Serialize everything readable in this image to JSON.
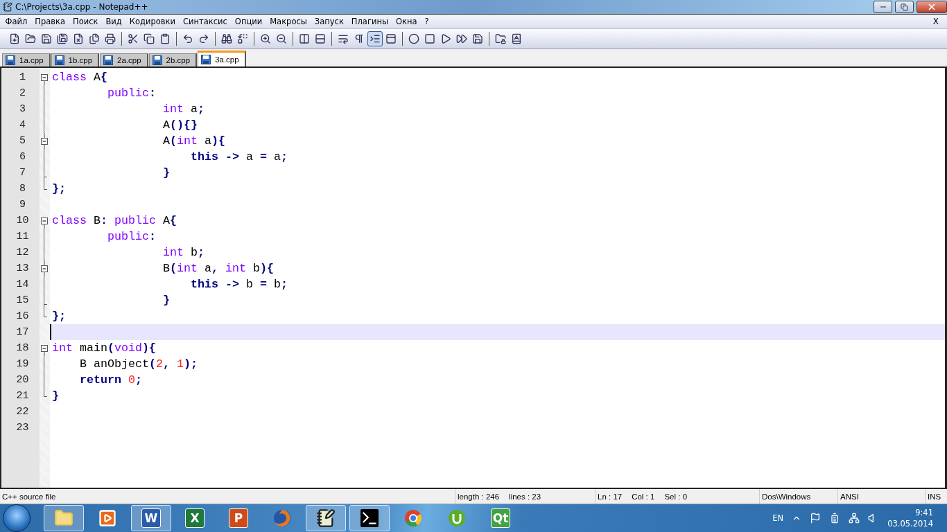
{
  "window": {
    "title": "C:\\Projects\\3a.cpp - Notepad++"
  },
  "menu": {
    "items": [
      "Файл",
      "Правка",
      "Поиск",
      "Вид",
      "Кодировки",
      "Синтаксис",
      "Опции",
      "Макросы",
      "Запуск",
      "Плагины",
      "Окна",
      "?"
    ],
    "close": "X"
  },
  "toolbar": [
    {
      "kind": "new",
      "selected": false
    },
    {
      "kind": "open",
      "selected": false
    },
    {
      "kind": "save",
      "selected": false
    },
    {
      "kind": "saveall",
      "selected": false
    },
    {
      "kind": "close",
      "selected": false
    },
    {
      "kind": "closeall",
      "selected": false
    },
    {
      "kind": "print",
      "selected": false
    },
    {
      "kind": "sep"
    },
    {
      "kind": "cut",
      "selected": false
    },
    {
      "kind": "copy",
      "selected": false
    },
    {
      "kind": "paste",
      "selected": false
    },
    {
      "kind": "sep"
    },
    {
      "kind": "undo",
      "selected": false
    },
    {
      "kind": "redo",
      "selected": false
    },
    {
      "kind": "sep"
    },
    {
      "kind": "find",
      "selected": false
    },
    {
      "kind": "replace",
      "selected": false
    },
    {
      "kind": "sep"
    },
    {
      "kind": "zoomin",
      "selected": false
    },
    {
      "kind": "zoomout",
      "selected": false
    },
    {
      "kind": "sep"
    },
    {
      "kind": "syncv",
      "selected": false
    },
    {
      "kind": "synch",
      "selected": false
    },
    {
      "kind": "sep"
    },
    {
      "kind": "wrap",
      "selected": false
    },
    {
      "kind": "allchars",
      "selected": false
    },
    {
      "kind": "indentguide",
      "selected": true
    },
    {
      "kind": "panel",
      "selected": false
    },
    {
      "kind": "sep"
    },
    {
      "kind": "record",
      "selected": false
    },
    {
      "kind": "stop",
      "selected": false
    },
    {
      "kind": "play",
      "selected": false
    },
    {
      "kind": "playmulti",
      "selected": false
    },
    {
      "kind": "savemacro",
      "selected": false
    },
    {
      "kind": "sep"
    },
    {
      "kind": "folderlock",
      "selected": false
    },
    {
      "kind": "spell",
      "selected": false
    }
  ],
  "tabs": [
    {
      "label": "1a.cpp",
      "selected": false
    },
    {
      "label": "1b.cpp",
      "selected": false
    },
    {
      "label": "2a.cpp",
      "selected": false
    },
    {
      "label": "2b.cpp",
      "selected": false
    },
    {
      "label": "3a.cpp",
      "selected": true
    }
  ],
  "editor": {
    "lines": [
      {
        "number": "1",
        "kind": "open",
        "current": false,
        "tokens": [
          {
            "kind": "type",
            "text": "class"
          },
          {
            "kind": "plain",
            "text": " A"
          },
          {
            "kind": "op",
            "text": "{"
          }
        ]
      },
      {
        "number": "2",
        "kind": "body",
        "current": false,
        "tokens": [
          {
            "kind": "type",
            "text": "\tpublic"
          },
          {
            "kind": "op",
            "text": ":"
          }
        ]
      },
      {
        "number": "3",
        "kind": "body",
        "current": false,
        "tokens": [
          {
            "kind": "type",
            "text": "\t\tint"
          },
          {
            "kind": "plain",
            "text": " a"
          },
          {
            "kind": "op",
            "text": ";"
          }
        ]
      },
      {
        "number": "4",
        "kind": "body",
        "current": false,
        "tokens": [
          {
            "kind": "plain",
            "text": "\t\tA"
          },
          {
            "kind": "op",
            "text": "(){}"
          }
        ]
      },
      {
        "number": "5",
        "kind": "subopen",
        "current": false,
        "tokens": [
          {
            "kind": "plain",
            "text": "\t\tA"
          },
          {
            "kind": "op",
            "text": "("
          },
          {
            "kind": "type",
            "text": "int"
          },
          {
            "kind": "plain",
            "text": " a"
          },
          {
            "kind": "op",
            "text": "){"
          }
        ]
      },
      {
        "number": "6",
        "kind": "body",
        "current": false,
        "tokens": [
          {
            "kind": "instr",
            "text": "\t\t    this"
          },
          {
            "kind": "op",
            "text": " ->"
          },
          {
            "kind": "plain",
            "text": " a "
          },
          {
            "kind": "op",
            "text": "="
          },
          {
            "kind": "plain",
            "text": " a"
          },
          {
            "kind": "op",
            "text": ";"
          }
        ]
      },
      {
        "number": "7",
        "kind": "subclose",
        "current": false,
        "tokens": [
          {
            "kind": "op",
            "text": "\t\t}"
          }
        ]
      },
      {
        "number": "8",
        "kind": "close",
        "current": false,
        "tokens": [
          {
            "kind": "op",
            "text": "};"
          }
        ]
      },
      {
        "number": "9",
        "kind": "blank",
        "current": false
      },
      {
        "number": "10",
        "kind": "open",
        "current": false,
        "tokens": [
          {
            "kind": "type",
            "text": "class"
          },
          {
            "kind": "plain",
            "text": " B"
          },
          {
            "kind": "op",
            "text": ":"
          },
          {
            "kind": "type",
            "text": " public"
          },
          {
            "kind": "plain",
            "text": " A"
          },
          {
            "kind": "op",
            "text": "{"
          }
        ]
      },
      {
        "number": "11",
        "kind": "body",
        "current": false,
        "tokens": [
          {
            "kind": "type",
            "text": "\tpublic"
          },
          {
            "kind": "op",
            "text": ":"
          }
        ]
      },
      {
        "number": "12",
        "kind": "body",
        "current": false,
        "tokens": [
          {
            "kind": "type",
            "text": "\t\tint"
          },
          {
            "kind": "plain",
            "text": " b"
          },
          {
            "kind": "op",
            "text": ";"
          }
        ]
      },
      {
        "number": "13",
        "kind": "subopen",
        "current": false,
        "tokens": [
          {
            "kind": "plain",
            "text": "\t\tB"
          },
          {
            "kind": "op",
            "text": "("
          },
          {
            "kind": "type",
            "text": "int"
          },
          {
            "kind": "plain",
            "text": " a"
          },
          {
            "kind": "op",
            "text": ","
          },
          {
            "kind": "type",
            "text": " int"
          },
          {
            "kind": "plain",
            "text": " b"
          },
          {
            "kind": "op",
            "text": "){"
          }
        ]
      },
      {
        "number": "14",
        "kind": "body",
        "current": false,
        "tokens": [
          {
            "kind": "instr",
            "text": "\t\t    this"
          },
          {
            "kind": "op",
            "text": " ->"
          },
          {
            "kind": "plain",
            "text": " b "
          },
          {
            "kind": "op",
            "text": "="
          },
          {
            "kind": "plain",
            "text": " b"
          },
          {
            "kind": "op",
            "text": ";"
          }
        ]
      },
      {
        "number": "15",
        "kind": "subclose",
        "current": false,
        "tokens": [
          {
            "kind": "op",
            "text": "\t\t}"
          }
        ]
      },
      {
        "number": "16",
        "kind": "close",
        "current": false,
        "tokens": [
          {
            "kind": "op",
            "text": "};"
          }
        ]
      },
      {
        "number": "17",
        "kind": "blank",
        "current": true
      },
      {
        "number": "18",
        "kind": "open",
        "current": false,
        "tokens": [
          {
            "kind": "type",
            "text": "int"
          },
          {
            "kind": "plain",
            "text": " main"
          },
          {
            "kind": "op",
            "text": "("
          },
          {
            "kind": "type",
            "text": "void"
          },
          {
            "kind": "op",
            "text": "){"
          }
        ]
      },
      {
        "number": "19",
        "kind": "body",
        "current": false,
        "tokens": [
          {
            "kind": "plain",
            "text": "    B anObject"
          },
          {
            "kind": "op",
            "text": "("
          },
          {
            "kind": "num",
            "text": "2"
          },
          {
            "kind": "op",
            "text": ","
          },
          {
            "kind": "num",
            "text": " 1"
          },
          {
            "kind": "op",
            "text": ");"
          }
        ]
      },
      {
        "number": "20",
        "kind": "body",
        "current": false,
        "tokens": [
          {
            "kind": "instr",
            "text": "    return"
          },
          {
            "kind": "num",
            "text": " 0"
          },
          {
            "kind": "op",
            "text": ";"
          }
        ]
      },
      {
        "number": "21",
        "kind": "close",
        "current": false,
        "tokens": [
          {
            "kind": "op",
            "text": "}"
          }
        ]
      },
      {
        "number": "22",
        "kind": "blank",
        "current": false
      },
      {
        "number": "23",
        "kind": "blank",
        "current": false
      }
    ]
  },
  "status_bar": {
    "file_type": "C++ source file",
    "length": "length : 246",
    "lines": "lines : 23",
    "ln": "Ln : 17",
    "col": "Col : 1",
    "sel": "Sel : 0",
    "eol": "Dos\\Windows",
    "encoding": "ANSI",
    "mode": "INS"
  },
  "taskbar": {
    "apps": [
      {
        "kind": "explorer",
        "running": true
      },
      {
        "kind": "media",
        "running": false
      },
      {
        "kind": "word",
        "glyph": "W",
        "running": true
      },
      {
        "kind": "excel",
        "glyph": "X",
        "running": false
      },
      {
        "kind": "powerpoint",
        "glyph": "P",
        "running": false
      },
      {
        "kind": "firefox",
        "running": false
      },
      {
        "kind": "notepad",
        "running": true
      },
      {
        "kind": "console",
        "running": true
      },
      {
        "kind": "chrome",
        "running": false
      },
      {
        "kind": "torrent",
        "running": false
      },
      {
        "kind": "qt",
        "glyph": "Qt",
        "running": false
      }
    ],
    "language": "EN",
    "time": "9:41",
    "date": "03.05.2014"
  }
}
